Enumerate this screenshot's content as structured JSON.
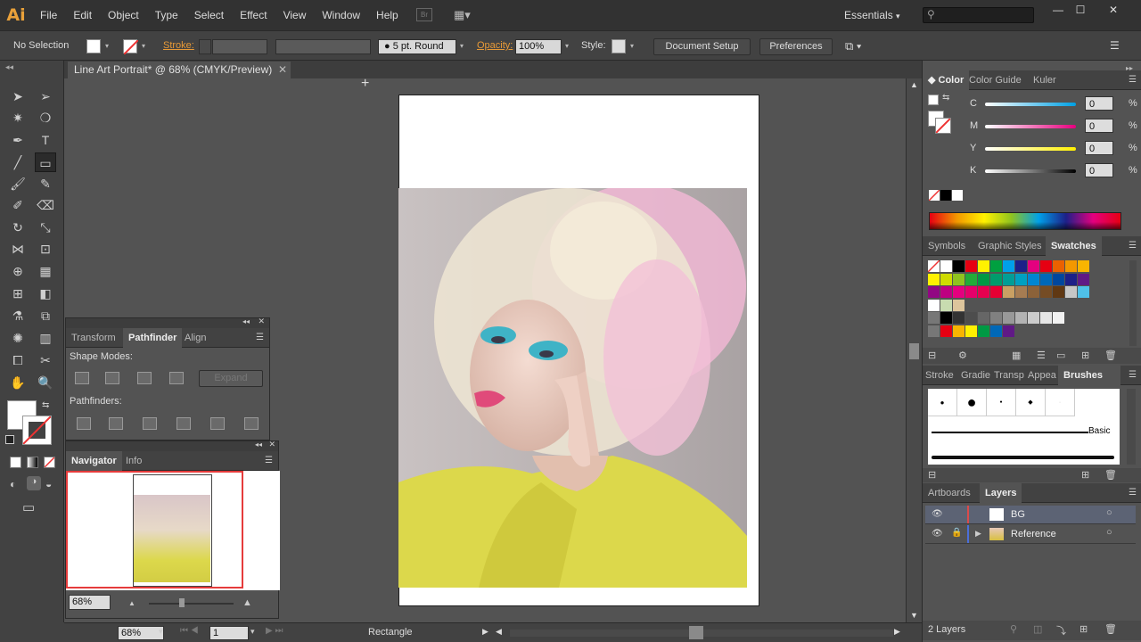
{
  "app": {
    "logo": "Ai"
  },
  "menu": [
    "File",
    "Edit",
    "Object",
    "Type",
    "Select",
    "Effect",
    "View",
    "Window",
    "Help"
  ],
  "bridge_badge": "Br",
  "workspace": "Essentials",
  "control": {
    "selection": "No Selection",
    "stroke_label": "Stroke:",
    "brush": "5 pt. Round",
    "opacity_label": "Opacity:",
    "opacity_value": "100%",
    "style_label": "Style:",
    "document_setup": "Document Setup",
    "preferences": "Preferences"
  },
  "document": {
    "tab_title": "Line Art Portrait* @ 68% (CMYK/Preview)"
  },
  "pathfinder_panel": {
    "tabs": [
      "Transform",
      "Pathfinder",
      "Align"
    ],
    "shape_modes": "Shape Modes:",
    "expand": "Expand",
    "pathfinders": "Pathfinders:"
  },
  "navigator_panel": {
    "tabs": [
      "Navigator",
      "Info"
    ],
    "zoom": "68%"
  },
  "color_panel": {
    "tabs": [
      "Color",
      "Color Guide",
      "Kuler"
    ],
    "channels": [
      {
        "label": "C",
        "value": "0",
        "unit": "%"
      },
      {
        "label": "M",
        "value": "0",
        "unit": "%"
      },
      {
        "label": "Y",
        "value": "0",
        "unit": "%"
      },
      {
        "label": "K",
        "value": "0",
        "unit": "%"
      }
    ]
  },
  "swatches_panel": {
    "tabs": [
      "Symbols",
      "Graphic Styles",
      "Swatches"
    ]
  },
  "brushes_panel": {
    "tabs": [
      "Stroke",
      "Gradie",
      "Transp",
      "Appea",
      "Brushes"
    ],
    "basic_label": "Basic"
  },
  "layers_panel": {
    "tabs": [
      "Artboards",
      "Layers"
    ],
    "layers": [
      {
        "name": "BG",
        "color": "#d94b4b"
      },
      {
        "name": "Reference",
        "color": "#4b6fd9"
      }
    ],
    "count": "2 Layers"
  },
  "status": {
    "zoom": "68%",
    "artboard": "1",
    "tool": "Rectangle"
  },
  "colors": {
    "accent": "#e89a37",
    "panel_bg": "#535353",
    "chrome": "#424242"
  }
}
